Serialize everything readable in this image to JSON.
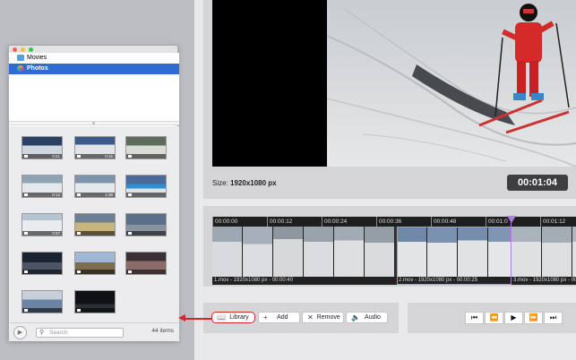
{
  "preview": {
    "size_label": "Size:",
    "size_value": "1920x1080 px",
    "timecode": "00:01:04"
  },
  "timeline": {
    "ticks": [
      "00:00:00",
      "00:00:12",
      "00:00:24",
      "00:00:36",
      "00:00:48",
      "00:01:0",
      "00:01:12"
    ],
    "clips": [
      {
        "label": "1.mov - 1920x1080 px - 00:00:40"
      },
      {
        "label": "2.mov - 1920x1080 px - 00:00:25"
      },
      {
        "label": "3.mov - 1920x1080 px - 00:00:..."
      }
    ]
  },
  "toolbar": {
    "library_label": "Library",
    "add_label": "Add",
    "remove_label": "Remove",
    "audio_label": "Audio",
    "library_icon": "book-icon",
    "add_icon": "plus-icon",
    "remove_icon": "x-icon",
    "audio_icon": "speaker-icon"
  },
  "transport": {
    "icons": [
      "skip-to-start-icon",
      "rewind-icon",
      "play-icon",
      "fast-forward-icon",
      "skip-to-end-icon"
    ]
  },
  "library": {
    "sources": [
      {
        "label": "Movies",
        "icon": "folder-icon"
      },
      {
        "label": "Photos",
        "icon": "photos-icon"
      }
    ],
    "thumbnails": [
      {
        "duration": "0:21"
      },
      {
        "duration": "0:16"
      },
      {
        "duration": ""
      },
      {
        "duration": "0:12"
      },
      {
        "duration": "1:38"
      },
      {
        "duration": ""
      },
      {
        "duration": "0:37"
      },
      {
        "duration": ""
      },
      {
        "duration": ""
      },
      {
        "duration": ""
      },
      {
        "duration": ""
      },
      {
        "duration": ""
      },
      {
        "duration": ""
      },
      {
        "duration": ""
      }
    ],
    "search_placeholder": "Search",
    "item_count": "44 items"
  },
  "colors": {
    "accent_blue": "#2d6cd0",
    "highlight_red": "#d4282c",
    "playhead_purple": "#b17fd8",
    "selection_gold": "#d8a21c"
  }
}
